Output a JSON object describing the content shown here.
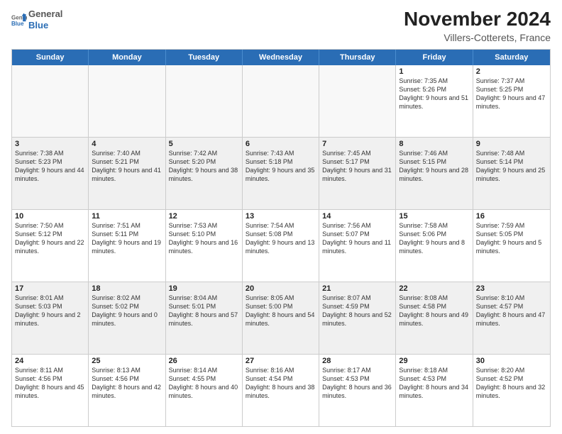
{
  "logo": {
    "general": "General",
    "blue": "Blue"
  },
  "title": "November 2024",
  "location": "Villers-Cotterets, France",
  "weekdays": [
    "Sunday",
    "Monday",
    "Tuesday",
    "Wednesday",
    "Thursday",
    "Friday",
    "Saturday"
  ],
  "rows": [
    [
      {
        "day": "",
        "info": ""
      },
      {
        "day": "",
        "info": ""
      },
      {
        "day": "",
        "info": ""
      },
      {
        "day": "",
        "info": ""
      },
      {
        "day": "",
        "info": ""
      },
      {
        "day": "1",
        "info": "Sunrise: 7:35 AM\nSunset: 5:26 PM\nDaylight: 9 hours and 51 minutes."
      },
      {
        "day": "2",
        "info": "Sunrise: 7:37 AM\nSunset: 5:25 PM\nDaylight: 9 hours and 47 minutes."
      }
    ],
    [
      {
        "day": "3",
        "info": "Sunrise: 7:38 AM\nSunset: 5:23 PM\nDaylight: 9 hours and 44 minutes."
      },
      {
        "day": "4",
        "info": "Sunrise: 7:40 AM\nSunset: 5:21 PM\nDaylight: 9 hours and 41 minutes."
      },
      {
        "day": "5",
        "info": "Sunrise: 7:42 AM\nSunset: 5:20 PM\nDaylight: 9 hours and 38 minutes."
      },
      {
        "day": "6",
        "info": "Sunrise: 7:43 AM\nSunset: 5:18 PM\nDaylight: 9 hours and 35 minutes."
      },
      {
        "day": "7",
        "info": "Sunrise: 7:45 AM\nSunset: 5:17 PM\nDaylight: 9 hours and 31 minutes."
      },
      {
        "day": "8",
        "info": "Sunrise: 7:46 AM\nSunset: 5:15 PM\nDaylight: 9 hours and 28 minutes."
      },
      {
        "day": "9",
        "info": "Sunrise: 7:48 AM\nSunset: 5:14 PM\nDaylight: 9 hours and 25 minutes."
      }
    ],
    [
      {
        "day": "10",
        "info": "Sunrise: 7:50 AM\nSunset: 5:12 PM\nDaylight: 9 hours and 22 minutes."
      },
      {
        "day": "11",
        "info": "Sunrise: 7:51 AM\nSunset: 5:11 PM\nDaylight: 9 hours and 19 minutes."
      },
      {
        "day": "12",
        "info": "Sunrise: 7:53 AM\nSunset: 5:10 PM\nDaylight: 9 hours and 16 minutes."
      },
      {
        "day": "13",
        "info": "Sunrise: 7:54 AM\nSunset: 5:08 PM\nDaylight: 9 hours and 13 minutes."
      },
      {
        "day": "14",
        "info": "Sunrise: 7:56 AM\nSunset: 5:07 PM\nDaylight: 9 hours and 11 minutes."
      },
      {
        "day": "15",
        "info": "Sunrise: 7:58 AM\nSunset: 5:06 PM\nDaylight: 9 hours and 8 minutes."
      },
      {
        "day": "16",
        "info": "Sunrise: 7:59 AM\nSunset: 5:05 PM\nDaylight: 9 hours and 5 minutes."
      }
    ],
    [
      {
        "day": "17",
        "info": "Sunrise: 8:01 AM\nSunset: 5:03 PM\nDaylight: 9 hours and 2 minutes."
      },
      {
        "day": "18",
        "info": "Sunrise: 8:02 AM\nSunset: 5:02 PM\nDaylight: 9 hours and 0 minutes."
      },
      {
        "day": "19",
        "info": "Sunrise: 8:04 AM\nSunset: 5:01 PM\nDaylight: 8 hours and 57 minutes."
      },
      {
        "day": "20",
        "info": "Sunrise: 8:05 AM\nSunset: 5:00 PM\nDaylight: 8 hours and 54 minutes."
      },
      {
        "day": "21",
        "info": "Sunrise: 8:07 AM\nSunset: 4:59 PM\nDaylight: 8 hours and 52 minutes."
      },
      {
        "day": "22",
        "info": "Sunrise: 8:08 AM\nSunset: 4:58 PM\nDaylight: 8 hours and 49 minutes."
      },
      {
        "day": "23",
        "info": "Sunrise: 8:10 AM\nSunset: 4:57 PM\nDaylight: 8 hours and 47 minutes."
      }
    ],
    [
      {
        "day": "24",
        "info": "Sunrise: 8:11 AM\nSunset: 4:56 PM\nDaylight: 8 hours and 45 minutes."
      },
      {
        "day": "25",
        "info": "Sunrise: 8:13 AM\nSunset: 4:56 PM\nDaylight: 8 hours and 42 minutes."
      },
      {
        "day": "26",
        "info": "Sunrise: 8:14 AM\nSunset: 4:55 PM\nDaylight: 8 hours and 40 minutes."
      },
      {
        "day": "27",
        "info": "Sunrise: 8:16 AM\nSunset: 4:54 PM\nDaylight: 8 hours and 38 minutes."
      },
      {
        "day": "28",
        "info": "Sunrise: 8:17 AM\nSunset: 4:53 PM\nDaylight: 8 hours and 36 minutes."
      },
      {
        "day": "29",
        "info": "Sunrise: 8:18 AM\nSunset: 4:53 PM\nDaylight: 8 hours and 34 minutes."
      },
      {
        "day": "30",
        "info": "Sunrise: 8:20 AM\nSunset: 4:52 PM\nDaylight: 8 hours and 32 minutes."
      }
    ]
  ]
}
